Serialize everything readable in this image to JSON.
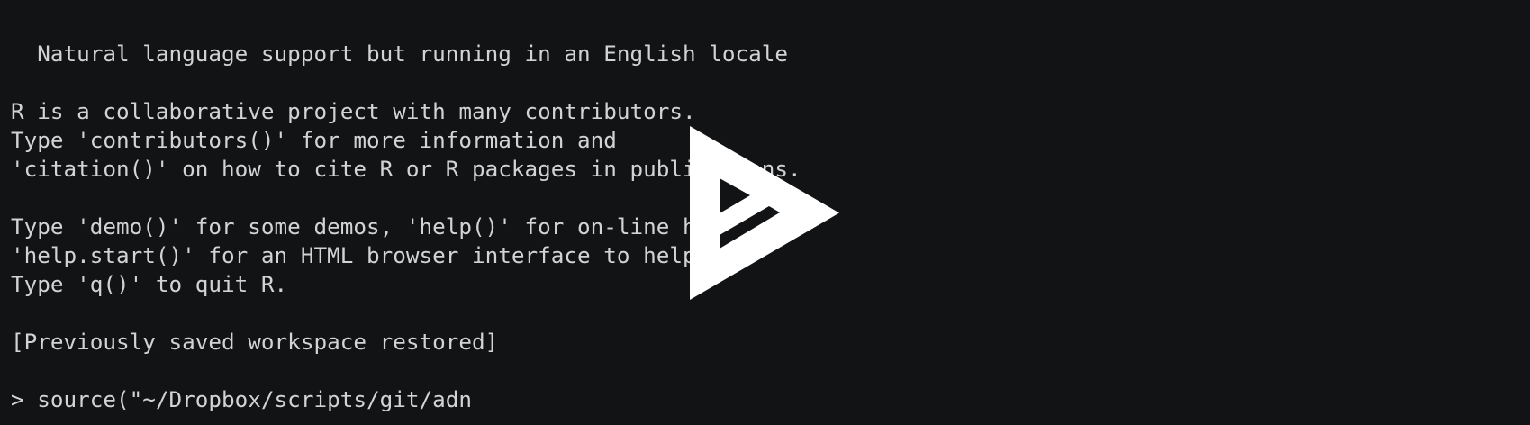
{
  "terminal": {
    "lines": [
      "  Natural language support but running in an English locale",
      "",
      "R is a collaborative project with many contributors.",
      "Type 'contributors()' for more information and",
      "'citation()' on how to cite R or R packages in publications.",
      "",
      "Type 'demo()' for some demos, 'help()' for on-line help, or",
      "'help.start()' for an HTML browser interface to help.",
      "Type 'q()' to quit R.",
      "",
      "[Previously saved workspace restored]",
      "",
      "> source(\"~/Dropbox/scripts/git/adn"
    ]
  },
  "overlay": {
    "icon": "asciinema-play-icon",
    "color": "#ffffff"
  },
  "colors": {
    "background": "#121315",
    "text": "#d3d3d3"
  }
}
